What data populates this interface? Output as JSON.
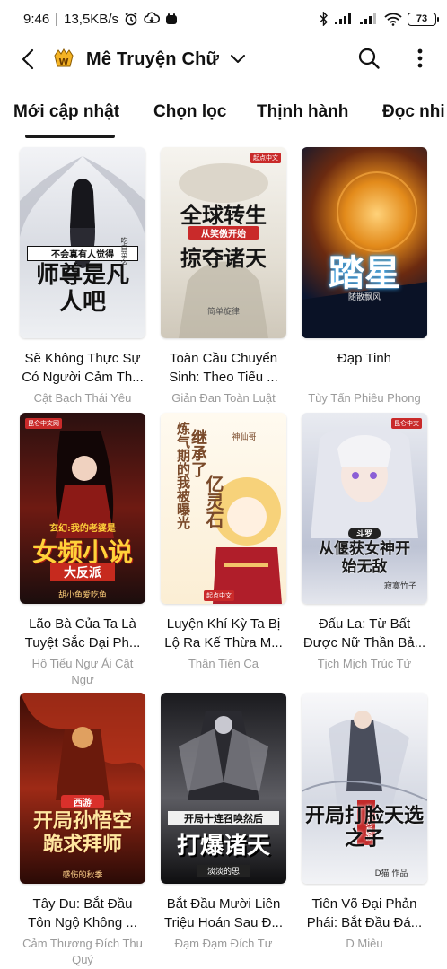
{
  "status_bar": {
    "time": "9:46",
    "speed": "13,5KB/s",
    "battery": "73"
  },
  "header": {
    "title": "Mê Truyện Chữ",
    "back_icon": "chevron-left-icon",
    "logo_icon": "app-logo-icon",
    "caret_icon": "chevron-down-icon",
    "search_icon": "search-icon",
    "more_icon": "more-vertical-icon"
  },
  "tabs": [
    {
      "label": "Mới cập nhật",
      "active": true
    },
    {
      "label": "Chọn lọc",
      "active": false
    },
    {
      "label": "Thịnh hành",
      "active": false
    },
    {
      "label": "Đọc nhi",
      "active": false
    }
  ],
  "books": [
    {
      "title": "Sẽ Không Thực Sự Có Người Cảm Th...",
      "author": "Cật Bạch Thái Yêu",
      "cover_text_top": "不会真有人觉得",
      "cover_text_main": "师尊是凡人吧",
      "cover_text_side": "吃白菜么",
      "colors": {
        "bg1": "#eef0f4",
        "bg2": "#c9ccd4",
        "text": "#111111",
        "accent": "#d9342b"
      }
    },
    {
      "title": "Toàn Cầu Chuyển Sinh: Theo Tiếu ...",
      "author": "Giản Đan Toàn Luật",
      "cover_text_top": "全球转生",
      "cover_text_mid": "从笑傲开始",
      "cover_text_main": "掠夺诸天",
      "cover_text_side": "简单旋律",
      "publisher": "起点中文",
      "colors": {
        "bg1": "#f3f1ec",
        "bg2": "#d8d3c8",
        "text": "#151515",
        "accent": "#c92a2a"
      }
    },
    {
      "title": "Đạp Tinh",
      "author": "Tùy Tấn Phiêu Phong",
      "cover_text_main": "踏星",
      "cover_text_side": "随散飘风",
      "colors": {
        "bg1": "#0b1630",
        "bg2": "#d88a1a",
        "text": "#ffffff",
        "accent": "#3fb6ff"
      }
    },
    {
      "title": "Lão Bà Của Ta Là Tuyệt Sắc Đại Ph...",
      "author": "Hồ Tiểu Ngư Ái Cật Ngư",
      "cover_text_top": "玄幻:我的老婆是",
      "cover_text_main": "女频小说",
      "cover_text_mid": "大反派",
      "cover_text_side": "胡小鱼爱吃鱼",
      "publisher": "昆仑中文网",
      "colors": {
        "bg1": "#1b0d0d",
        "bg2": "#8a1b12",
        "text": "#ffd23a",
        "accent": "#e23b22"
      }
    },
    {
      "title": "Luyện Khí Kỳ Ta Bị Lộ Ra Kế Thừa M...",
      "author": "Thần Tiên Ca",
      "cover_text_top": "继承了",
      "cover_text_main": "亿灵石",
      "cover_text_side": "炼气期的我被曝光",
      "cover_text_author": "神仙哥",
      "publisher": "起点中文",
      "colors": {
        "bg1": "#fbf4e6",
        "bg2": "#f2c46a",
        "text": "#7a4a2a",
        "accent": "#d23c2c"
      }
    },
    {
      "title": "Đấu La: Từ Bất Được Nữ Thần Bả...",
      "author": "Tịch Mịch Trúc Tử",
      "cover_text_main": "从偃获女神开始无敌",
      "cover_text_side": "寂寞竹子",
      "cover_text_top": "斗罗",
      "publisher": "昆仑中文",
      "colors": {
        "bg1": "#dfe2ea",
        "bg2": "#a9b0c4",
        "text": "#1a1a1a",
        "accent": "#8b5fd6"
      }
    },
    {
      "title": "Tây Du: Bắt Đầu Tôn Ngộ Không ...",
      "author": "Cảm Thương Đích Thu Quý",
      "cover_text_top": "西游",
      "cover_text_main": "开局孙悟空跪求拜师",
      "cover_text_side": "感伤的秋季",
      "colors": {
        "bg1": "#2a0a06",
        "bg2": "#c2361c",
        "text": "#ffe7a0",
        "accent": "#ff9a1f"
      }
    },
    {
      "title": "Bắt Đầu Mười Liên Triệu Hoán Sau Đ...",
      "author": "Đạm Đạm Đích Tư",
      "cover_text_top": "开局十连召唤然后",
      "cover_text_main": "打爆诸天",
      "cover_text_side": "淡淡的思",
      "colors": {
        "bg1": "#0e0e10",
        "bg2": "#6b6b70",
        "text": "#ffffff",
        "accent": "#b8b8c0"
      }
    },
    {
      "title": "Tiên Võ Đại Phản Phái: Bắt Đầu Đá...",
      "author": "D Miêu",
      "cover_text_main": "开局打脸天选之子",
      "cover_text_side": "D猫 作品",
      "cover_text_top": "仙武大反派",
      "colors": {
        "bg1": "#f4f4f6",
        "bg2": "#c7cbd6",
        "text": "#111111",
        "accent": "#c22a2a"
      }
    }
  ]
}
